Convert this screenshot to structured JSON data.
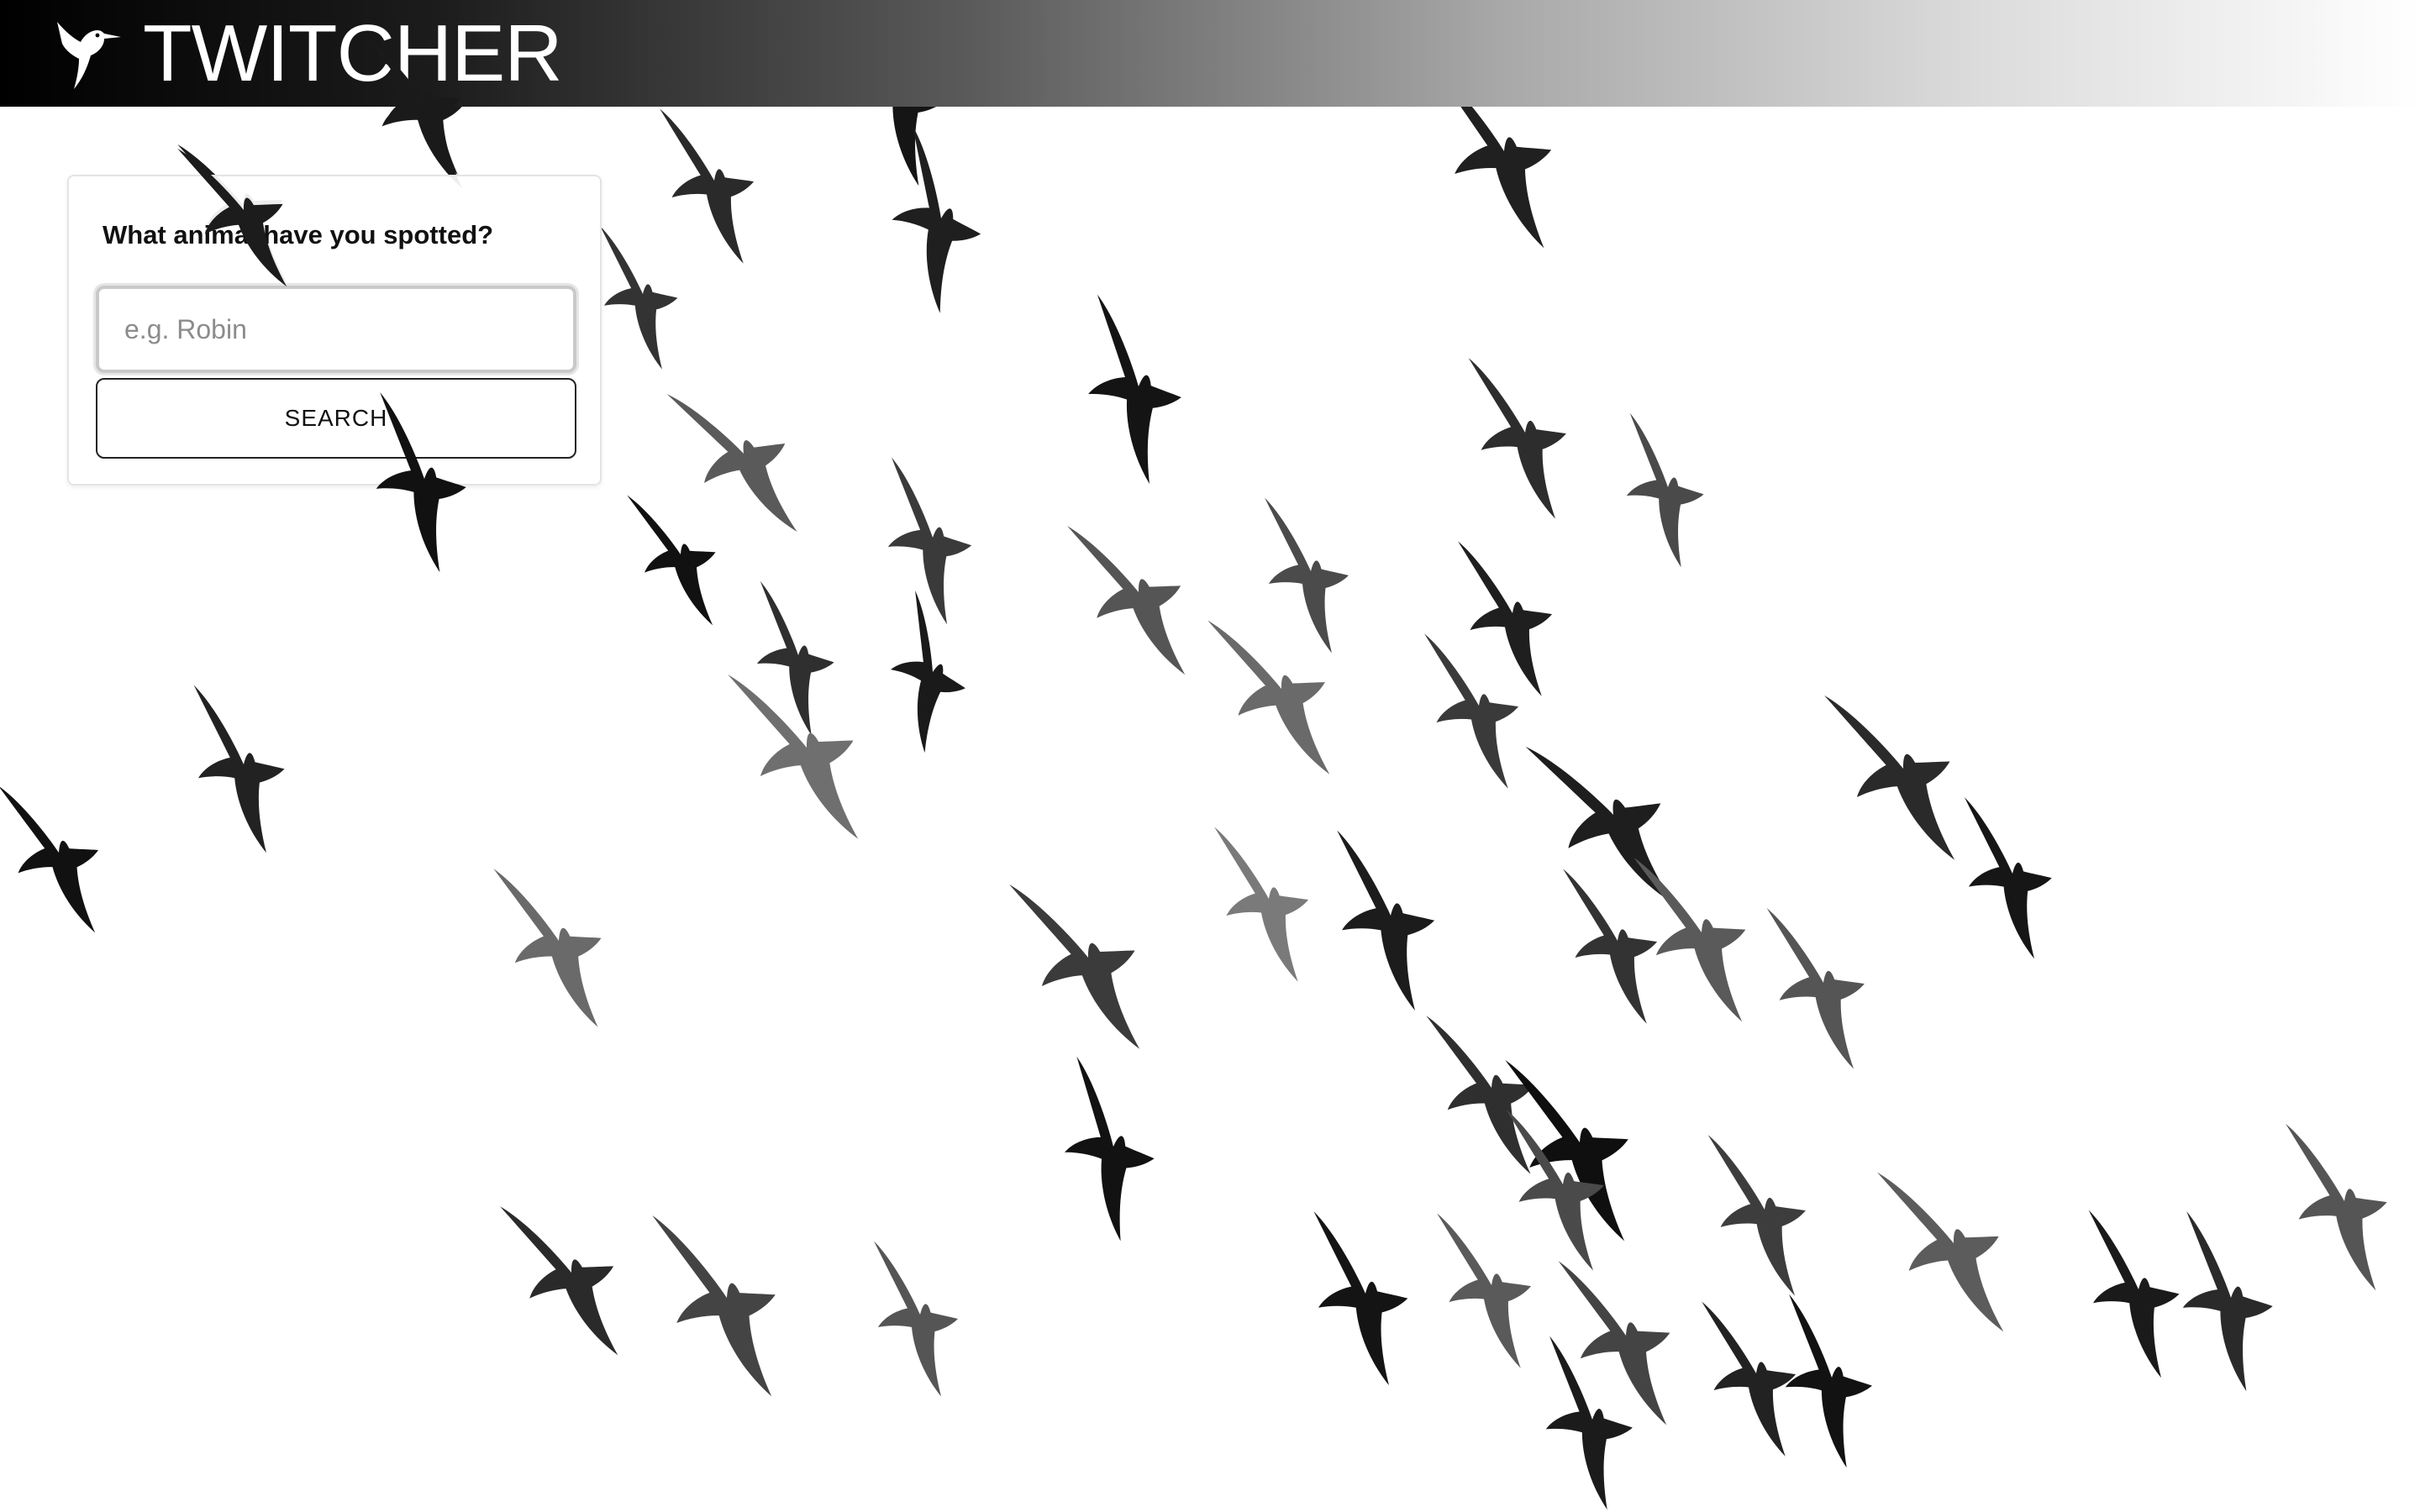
{
  "header": {
    "brand": "TWITCHER",
    "logo_icon": "hummingbird-icon"
  },
  "search_card": {
    "prompt": "What animal have you spotted?",
    "input_placeholder": "e.g. Robin",
    "input_value": "",
    "button_label": "SEARCH"
  },
  "background": {
    "image_subject": "flock-of-birds-photo"
  },
  "colors": {
    "header_gradient_start": "#000000",
    "header_gradient_end": "#ffffff",
    "button_border": "#222222"
  }
}
